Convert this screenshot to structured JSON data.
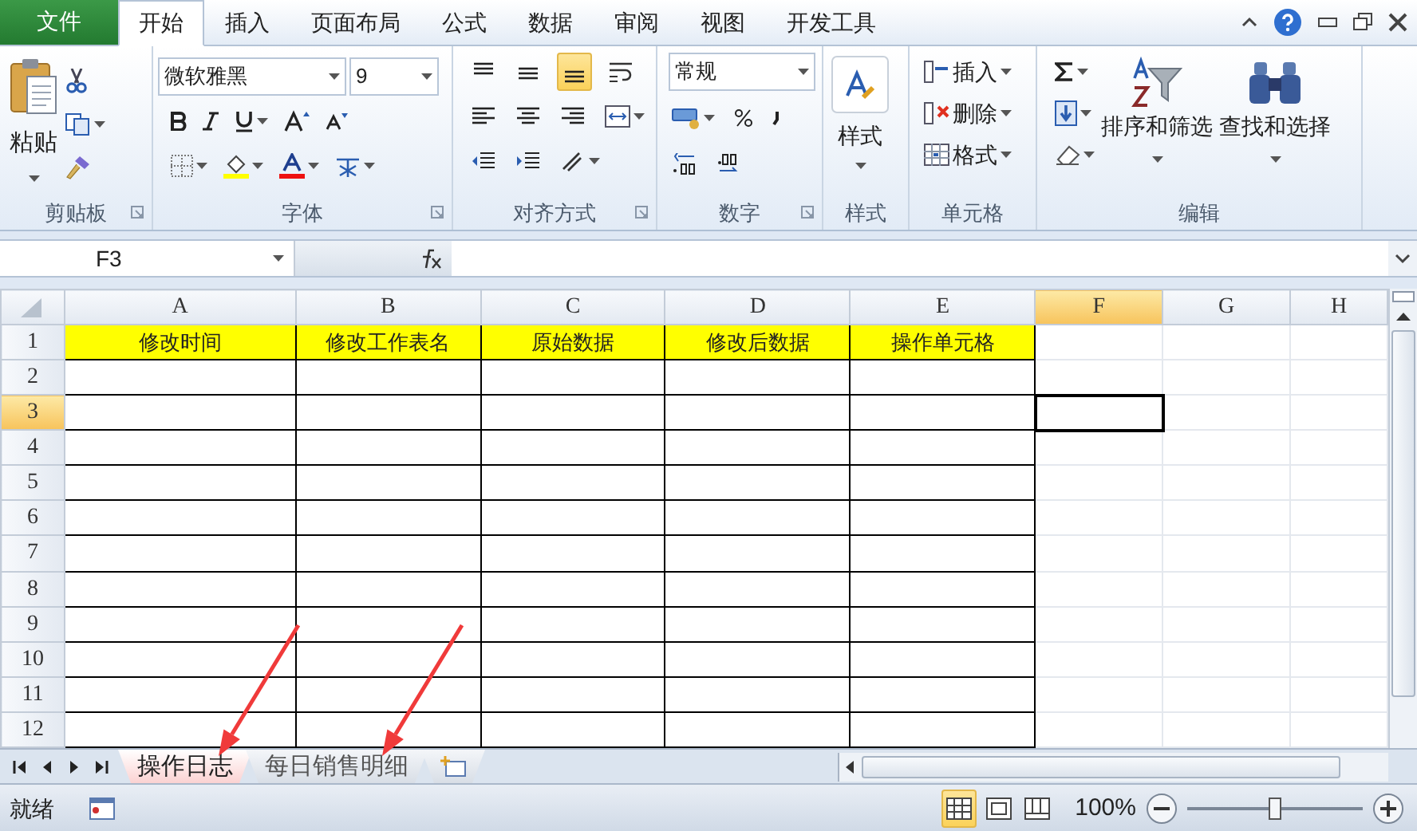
{
  "menu_tabs": [
    {
      "label": "文件",
      "kind": "file",
      "selected": false
    },
    {
      "label": "开始",
      "kind": "tab",
      "selected": true
    },
    {
      "label": "插入",
      "kind": "tab",
      "selected": false
    },
    {
      "label": "页面布局",
      "kind": "tab",
      "selected": false
    },
    {
      "label": "公式",
      "kind": "tab",
      "selected": false
    },
    {
      "label": "数据",
      "kind": "tab",
      "selected": false
    },
    {
      "label": "审阅",
      "kind": "tab",
      "selected": false
    },
    {
      "label": "视图",
      "kind": "tab",
      "selected": false
    },
    {
      "label": "开发工具",
      "kind": "tab",
      "selected": false
    }
  ],
  "ribbon": {
    "clipboard": {
      "label": "剪贴板",
      "paste": "粘贴"
    },
    "font": {
      "label": "字体",
      "font_name": "微软雅黑",
      "font_size": "9"
    },
    "alignment": {
      "label": "对齐方式",
      "vertical_align": [
        {
          "selected": false
        },
        {
          "selected": false
        },
        {
          "selected": true
        }
      ]
    },
    "number": {
      "label": "数字",
      "format": "常规"
    },
    "styles": {
      "label": "样式",
      "button": "样式"
    },
    "cells": {
      "label": "单元格",
      "buttons": [
        "插入",
        "删除",
        "格式"
      ]
    },
    "editing": {
      "label": "编辑",
      "buttons": [
        "排序和筛选",
        "查找和选择"
      ]
    }
  },
  "formula_bar": {
    "name_box": "F3"
  },
  "sheet": {
    "columns": [
      {
        "label": "A",
        "selected": false,
        "bordered": true
      },
      {
        "label": "B",
        "selected": false,
        "bordered": true
      },
      {
        "label": "C",
        "selected": false,
        "bordered": true
      },
      {
        "label": "D",
        "selected": false,
        "bordered": true
      },
      {
        "label": "E",
        "selected": false,
        "bordered": true
      },
      {
        "label": "F",
        "selected": true,
        "bordered": false
      },
      {
        "label": "G",
        "selected": false,
        "bordered": false
      },
      {
        "label": "H",
        "selected": false,
        "bordered": false
      }
    ],
    "rows": [
      {
        "number": "1",
        "selected": false,
        "filled": true,
        "cells": [
          "修改时间",
          "修改工作表名",
          "原始数据",
          "修改后数据",
          "操作单元格"
        ]
      },
      {
        "number": "2",
        "selected": false,
        "filled": false
      },
      {
        "number": "3",
        "selected": true,
        "filled": false
      },
      {
        "number": "4",
        "selected": false,
        "filled": false
      },
      {
        "number": "5",
        "selected": false,
        "filled": false
      },
      {
        "number": "6",
        "selected": false,
        "filled": false
      },
      {
        "number": "7",
        "selected": false,
        "filled": false
      },
      {
        "number": "8",
        "selected": false,
        "filled": false
      },
      {
        "number": "9",
        "selected": false,
        "filled": false
      },
      {
        "number": "10",
        "selected": false,
        "filled": false
      },
      {
        "number": "11",
        "selected": false,
        "filled": false
      },
      {
        "number": "12",
        "selected": false,
        "filled": false
      }
    ]
  },
  "sheet_tabs": [
    {
      "label": "操作日志",
      "selected": true,
      "arrow_annotation": true
    },
    {
      "label": "每日销售明细",
      "selected": false,
      "arrow_annotation": true
    }
  ],
  "status_bar": {
    "status": "就绪",
    "zoom": "100%",
    "zoom_slider": {
      "level": 0.5
    }
  }
}
